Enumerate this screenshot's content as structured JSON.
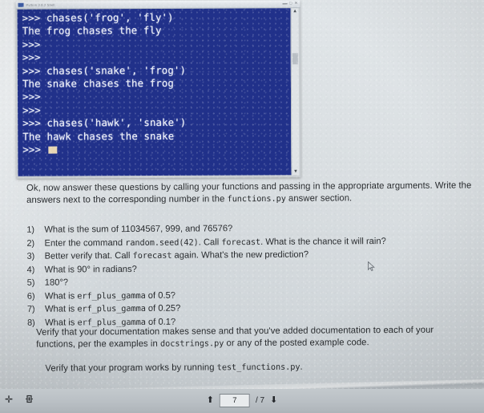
{
  "terminal": {
    "window_title": "Python 3.8.2 Shell",
    "lines": [
      ">>> chases('frog', 'fly')",
      "The frog chases the fly",
      ">>>",
      ">>>",
      ">>> chases('snake', 'frog')",
      "The snake chases the frog",
      ">>>",
      ">>>",
      ">>> chases('hawk', 'snake')",
      "The hawk chases the snake",
      ">>>"
    ],
    "background_color": "#21318a",
    "text_color": "#eef0f6",
    "cursor_color": "#e8d7b4",
    "scroll_up_icon": "scroll-up-arrow",
    "scroll_down_icon": "scroll-down-arrow"
  },
  "document": {
    "intro": {
      "part1": "Ok, now answer these questions by calling your functions and passing in the appropriate arguments. Write the answers next to the corresponding number in the ",
      "code1": "functions.py",
      "part2": " answer section."
    },
    "questions": [
      {
        "num": "1)",
        "segments": [
          {
            "t": "text",
            "v": "What is the sum of 11034567, 999, and 76576?"
          }
        ]
      },
      {
        "num": "2)",
        "segments": [
          {
            "t": "text",
            "v": "Enter the command "
          },
          {
            "t": "code",
            "v": "random.seed(42)"
          },
          {
            "t": "text",
            "v": ". Call "
          },
          {
            "t": "code",
            "v": "forecast"
          },
          {
            "t": "text",
            "v": ".  What is the chance it will rain?"
          }
        ]
      },
      {
        "num": "3)",
        "segments": [
          {
            "t": "text",
            "v": "Better verify that. Call "
          },
          {
            "t": "code",
            "v": "forecast"
          },
          {
            "t": "text",
            "v": " again.  What's the new prediction?"
          }
        ]
      },
      {
        "num": "4)",
        "segments": [
          {
            "t": "text",
            "v": "What is 90° in radians?"
          }
        ]
      },
      {
        "num": "5)",
        "segments": [
          {
            "t": "text",
            "v": "180°?"
          }
        ]
      },
      {
        "num": "6)",
        "segments": [
          {
            "t": "text",
            "v": "What is "
          },
          {
            "t": "code",
            "v": "erf_plus_gamma"
          },
          {
            "t": "text",
            "v": " of 0.5?"
          }
        ]
      },
      {
        "num": "7)",
        "segments": [
          {
            "t": "text",
            "v": "What is "
          },
          {
            "t": "code",
            "v": "erf_plus_gamma"
          },
          {
            "t": "text",
            "v": " of 0.25?"
          }
        ]
      },
      {
        "num": "8)",
        "segments": [
          {
            "t": "text",
            "v": "What is "
          },
          {
            "t": "code",
            "v": "erf_plus_gamma"
          },
          {
            "t": "text",
            "v": " of 0.1?"
          }
        ]
      }
    ],
    "paragraph2": {
      "part1": "Verify that your documentation makes sense and that you've added documentation to each of your functions, per the examples in ",
      "code1": "docstrings.py",
      "part2": " or any of the posted example code."
    },
    "paragraph3": {
      "part1": "Verify that your program works by running ",
      "code1": "test_functions.py",
      "part2": "."
    }
  },
  "toolbar": {
    "add_icon": "plus-icon",
    "fit_icon": "fit-page-icon",
    "prev_page_icon": "page-up-arrow",
    "next_page_icon": "page-down-arrow",
    "current_page": "7",
    "page_total": "/ 7"
  }
}
